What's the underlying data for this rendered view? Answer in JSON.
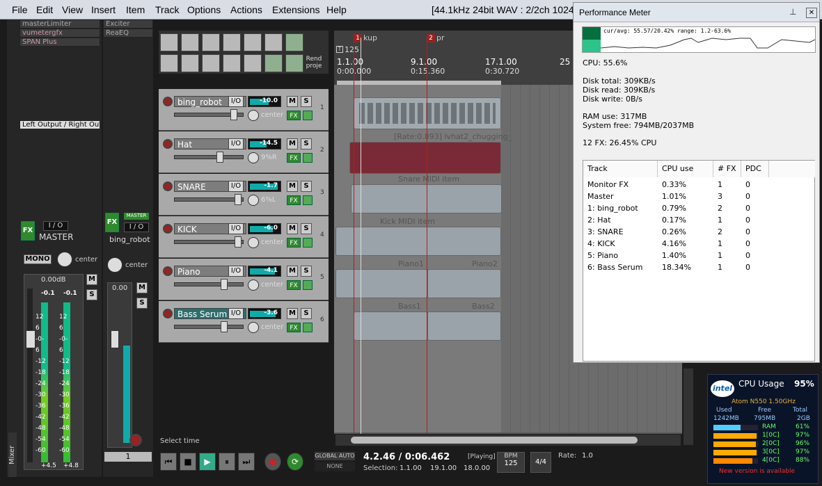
{
  "menu": [
    "File",
    "Edit",
    "View",
    "Insert",
    "Item",
    "Track",
    "Options",
    "Actions",
    "Extensions",
    "Help"
  ],
  "window_title": "[44.1kHz 24bit WAV : 2/2ch 1024",
  "fx_chain_master": [
    "masterLimiter",
    "vumetergfx",
    "SPAN Plus"
  ],
  "fx_chain_track": [
    "Exciter",
    "ReaEQ"
  ],
  "master": {
    "label": "MASTER",
    "io": "I / O",
    "mono": "MONO",
    "pan": "center",
    "db": "0.00dB",
    "peak_l": "-0.1",
    "peak_r": "-0.1",
    "scale": [
      "12",
      "6",
      "-0-",
      "6",
      "-12",
      "-18",
      "-24",
      "-30",
      "-36",
      "-42",
      "-48",
      "-54",
      "-60"
    ],
    "bottom_l": "+4.5",
    "bottom_r": "+4.8",
    "fx": "FX",
    "output": "Left Output / Right Outp"
  },
  "bing_strip": {
    "label": "bing_robot",
    "io": "I / O",
    "master_btn": "MASTER",
    "pan": "center",
    "db": "0.00",
    "num": "1"
  },
  "mixer_tab": "Mixer",
  "toolbar": {
    "render": "Rend proje"
  },
  "tracks": [
    {
      "name": "bing_robot",
      "vol": "-10.0",
      "pan": "center",
      "num": "1"
    },
    {
      "name": "Hat",
      "vol": "-14.5",
      "pan": "9%R",
      "num": "2"
    },
    {
      "name": "SNARE",
      "vol": "-1.7",
      "pan": "6%L",
      "num": "3"
    },
    {
      "name": "KICK",
      "vol": "-6.0",
      "pan": "center",
      "num": "4"
    },
    {
      "name": "Piano",
      "vol": "-4.1",
      "pan": "center",
      "num": "5"
    },
    {
      "name": "Bass Serum",
      "vol": "-3.6",
      "pan": "center",
      "num": "6"
    }
  ],
  "track_btns": {
    "io": "I/O",
    "m": "M",
    "s": "S",
    "fx": "FX"
  },
  "timeline": {
    "markers": [
      {
        "id": "1",
        "name": "kup"
      },
      {
        "id": "2",
        "name": "pr"
      }
    ],
    "tempo": "125",
    "bars": [
      {
        "bar": "1.1.00",
        "time": "0:00.000"
      },
      {
        "bar": "9.1.00",
        "time": "0:15.360"
      },
      {
        "bar": "17.1.00",
        "time": "0:30.720"
      },
      {
        "bar": "25",
        "time": ""
      }
    ]
  },
  "items": {
    "hat": "[Rate:0.893] lvhat2_chugging_",
    "snare": "Snare MIDI item",
    "kick": "Kick MIDI item",
    "piano1": "Piano1",
    "piano2": "Piano2",
    "bass1": "Bass1",
    "bass2": "Bass2"
  },
  "status": "Select time",
  "transport": {
    "pos": "4.2.46 / 0:06.462",
    "state": "[Playing]",
    "global_auto": "GLOBAL AUTO",
    "none": "NONE",
    "selection_label": "Selection:",
    "sel_start": "1.1.00",
    "sel_end": "19.1.00",
    "sel_len": "18.0.00",
    "bpm_label": "BPM",
    "bpm": "125",
    "ts": "4/4",
    "rate_label": "Rate:",
    "rate": "1.0"
  },
  "perf": {
    "title": "Performance Meter",
    "graph_text": "cur/avg: 55.57/20.42%  range: 1.2-63.6%",
    "cpu": "CPU: 55.6%",
    "disk_total": "Disk total: 309KB/s",
    "disk_read": "Disk read: 309KB/s",
    "disk_write": "Disk write: 0B/s",
    "ram_use": "RAM use: 317MB",
    "sys_free": "System free: 794MB/2037MB",
    "fx_cpu": "12 FX: 26.45% CPU",
    "columns": [
      "Track",
      "CPU use",
      "# FX",
      "PDC"
    ],
    "rows": [
      [
        "Monitor FX",
        "0.33%",
        "1",
        "0"
      ],
      [
        "Master",
        "1.01%",
        "3",
        "0"
      ],
      [
        "1: bing_robot",
        "0.79%",
        "2",
        "0"
      ],
      [
        "2: Hat",
        "0.17%",
        "1",
        "0"
      ],
      [
        "3: SNARE",
        "0.26%",
        "2",
        "0"
      ],
      [
        "4: KICK",
        "4.16%",
        "1",
        "0"
      ],
      [
        "5: Piano",
        "1.40%",
        "1",
        "0"
      ],
      [
        "6: Bass Serum",
        "18.34%",
        "1",
        "0"
      ]
    ]
  },
  "cpu_gadget": {
    "brand": "intel",
    "title": "CPU Usage",
    "pct": "95%",
    "proc": "Atom N550 1.50GHz",
    "headers": [
      "Used",
      "Free",
      "Total"
    ],
    "mem": [
      "1242MB",
      "795MB",
      "2GB"
    ],
    "bars": [
      {
        "label": "RAM",
        "val": "61%",
        "frac": 0.61
      },
      {
        "label": "1[0C]",
        "val": "97%",
        "frac": 0.97
      },
      {
        "label": "2[0C]",
        "val": "96%",
        "frac": 0.96
      },
      {
        "label": "3[0C]",
        "val": "97%",
        "frac": 0.97
      },
      {
        "label": "4[0C]",
        "val": "88%",
        "frac": 0.88
      }
    ],
    "update": "New version is available"
  }
}
